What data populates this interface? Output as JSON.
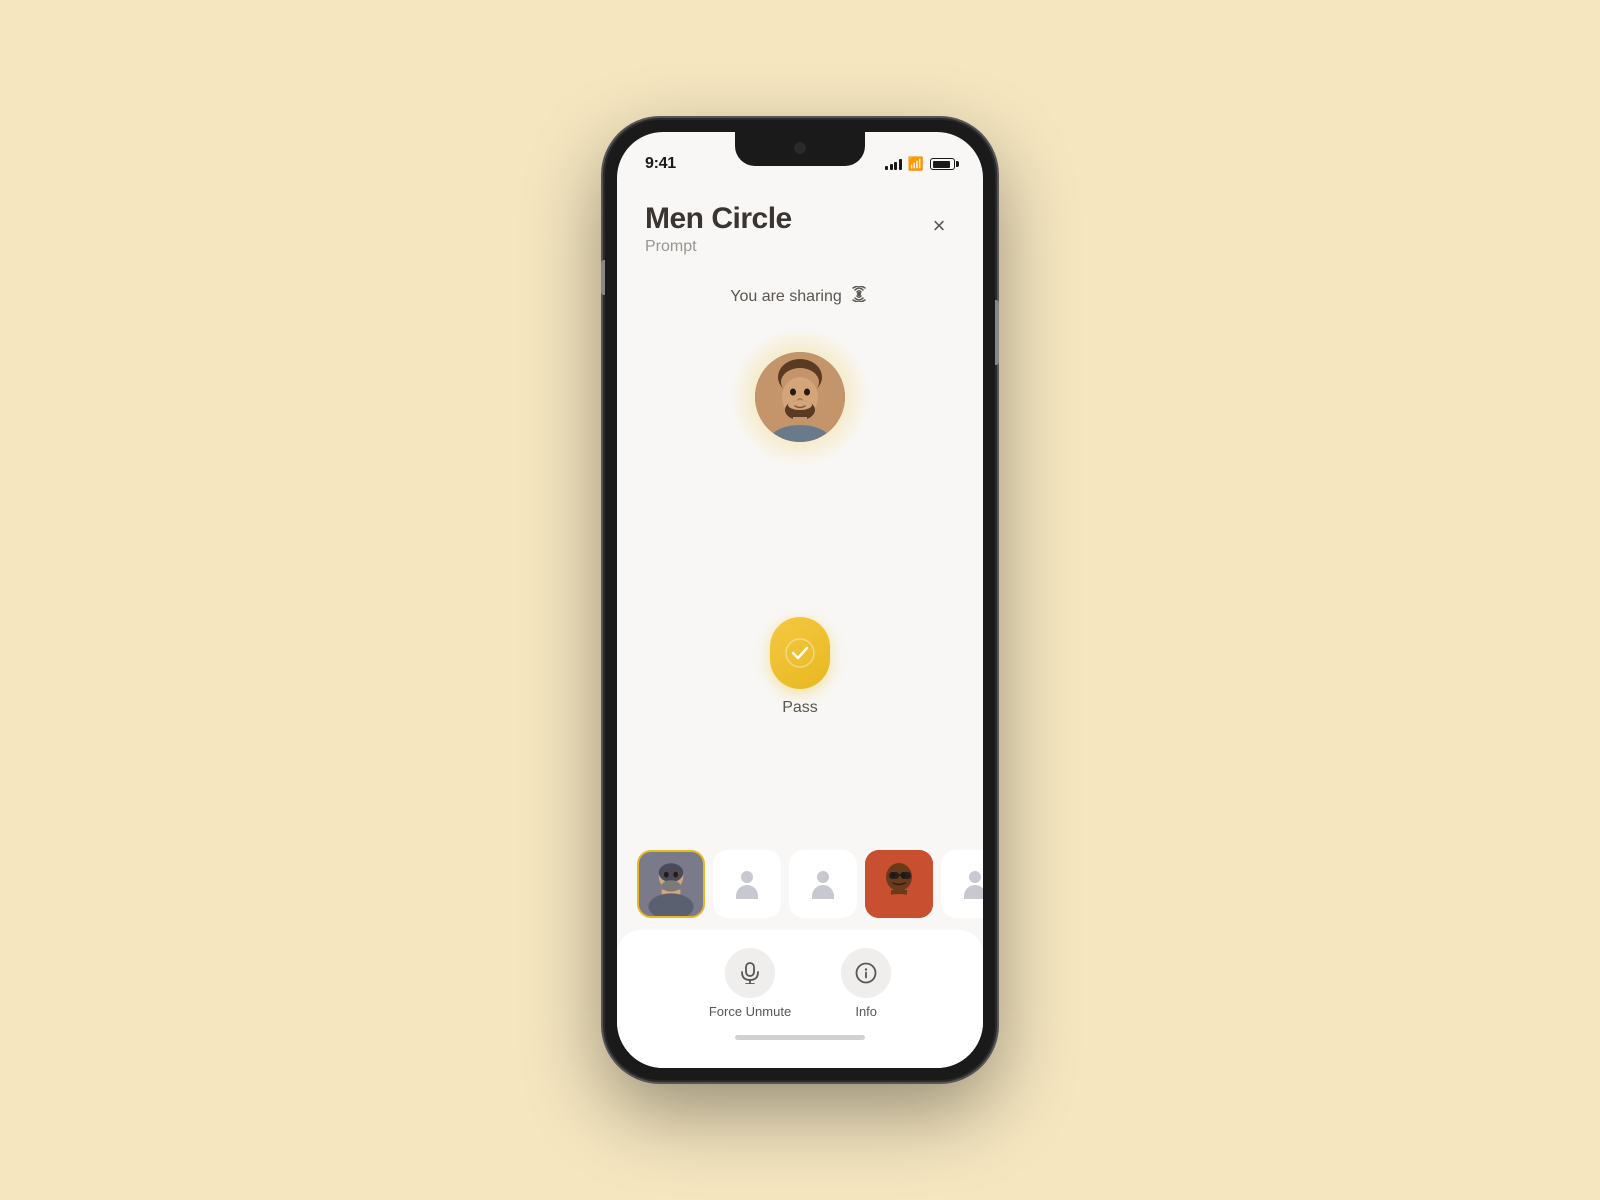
{
  "background_color": "#f5e6c0",
  "phone": {
    "status_bar": {
      "time": "9:41",
      "signal_bars": 4,
      "wifi": true,
      "battery_percent": 85
    },
    "header": {
      "title": "Men Circle",
      "subtitle": "Prompt",
      "close_label": "×"
    },
    "sharing": {
      "label": "You are sharing",
      "radio_symbol": "((·))"
    },
    "pass": {
      "label": "Pass",
      "check_symbol": "✓"
    },
    "participants": [
      {
        "type": "photo",
        "active": true,
        "bg": "person1"
      },
      {
        "type": "ghost"
      },
      {
        "type": "ghost"
      },
      {
        "type": "photo",
        "active": false,
        "bg": "person2"
      },
      {
        "type": "ghost"
      },
      {
        "type": "partial"
      }
    ],
    "actions": [
      {
        "id": "force-unmute",
        "label": "Force Unmute",
        "icon": "mic"
      },
      {
        "id": "info",
        "label": "Info",
        "icon": "info"
      }
    ]
  }
}
